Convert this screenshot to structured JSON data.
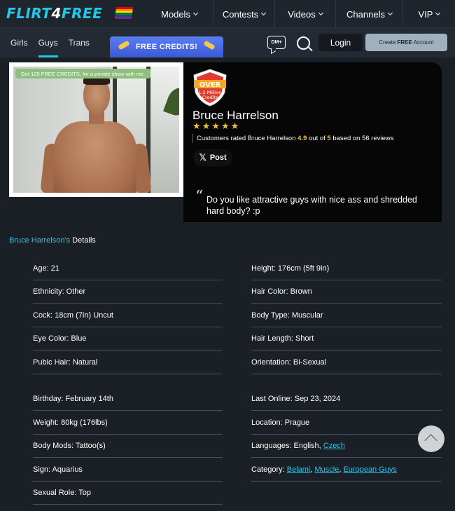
{
  "brand": {
    "logo_text_a": "FLIRT",
    "logo_text_b": "4",
    "logo_text_c": "FREE"
  },
  "main_nav": [
    {
      "label": "Models"
    },
    {
      "label": "Contests"
    },
    {
      "label": "Videos"
    },
    {
      "label": "Channels"
    },
    {
      "label": "VIP"
    }
  ],
  "sub_nav": [
    {
      "label": "Girls"
    },
    {
      "label": "Guys"
    },
    {
      "label": "Trans"
    }
  ],
  "free_credits": "FREE CREDITS!",
  "dm_label": "DM+",
  "login": "Login",
  "create_account": {
    "a": "Create",
    "b": "FREE",
    "c": "Account"
  },
  "promo_banner": "Get 120 FREE CREDITS, for a private show with me.",
  "badge": {
    "line1": "OVER",
    "line2": "1.5 Million",
    "line3": "Credits"
  },
  "profile": {
    "name": "Bruce Harrelson",
    "rating_prefix": "Customers rated Bruce Harrelson",
    "rating_value": "4.9",
    "rating_mid": "out of",
    "rating_max": "5",
    "rating_suffix": "based on 56 reviews",
    "stars": 5,
    "post_label": "Post",
    "quote_mark": "“",
    "quote": "Do you like attractive guys with nice ass and shredded hard body? :p"
  },
  "details": {
    "title_name": "Bruce Harrelson's",
    "title_rest": " Details",
    "left": [
      "Age: 21",
      "Ethnicity: Other",
      "Cock: 18cm (7in) Uncut",
      "Eye Color: Blue",
      "Pubic Hair: Natural",
      "Birthday: February 14th",
      "Weight: 80kg (176lbs)",
      "Body Mods: Tattoo(s)",
      "Sign: Aquarius",
      "Sexual Role: Top"
    ],
    "right": [
      "Height: 176cm (5ft 9in)",
      "Hair Color: Brown",
      "Body Type: Muscular",
      "Hair Length: Short",
      "Orientation: Bi-Sexual",
      "Last Online: Sep 23, 2024",
      "Location: Prague"
    ],
    "languages": {
      "prefix": "Languages: English, ",
      "link": "Czech"
    },
    "category": {
      "prefix": "Category: ",
      "links": [
        "Belami",
        "Muscle",
        "European Guys"
      ]
    }
  },
  "colors": {
    "accent": "#26c6e6",
    "star": "#f4c23a",
    "background": "#1b1f26"
  }
}
